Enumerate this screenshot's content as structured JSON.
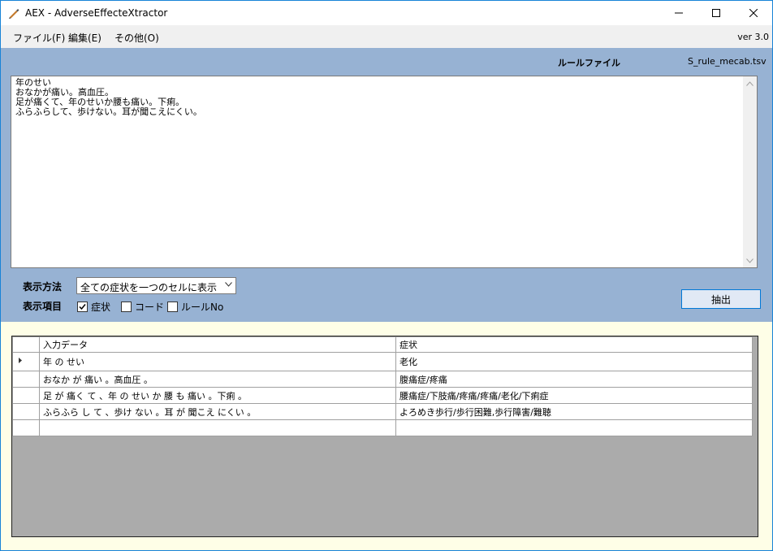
{
  "window": {
    "title": "AEX - AdverseEffecteXtractor",
    "minimize_icon": "minimize-icon",
    "maximize_icon": "maximize-icon",
    "close_icon": "close-icon"
  },
  "menu": {
    "items": [
      {
        "label": "ファイル(F)"
      },
      {
        "label": "編集(E)"
      },
      {
        "label": "その他(O)"
      }
    ],
    "version": "ver 3.0"
  },
  "rule": {
    "title": "ルールファイル",
    "file": "S_rule_mecab.tsv"
  },
  "input_text": {
    "lines": [
      "年のせい",
      "おなかが痛い。高血圧。",
      "足が痛くて、年のせいか腰も痛い。下痢。",
      "ふらふらして、歩けない。耳が聞こえにくい。"
    ]
  },
  "controls": {
    "display_method_label": "表示方法",
    "display_method_value": "全ての症状を一つのセルに表示",
    "display_items_label": "表示項目",
    "checkboxes": [
      {
        "label": "症状",
        "checked": true
      },
      {
        "label": "コード",
        "checked": false
      },
      {
        "label": "ルールNo",
        "checked": false
      }
    ],
    "extract_button": "抽出"
  },
  "grid": {
    "headers": [
      "入力データ",
      "症状"
    ],
    "rows": [
      [
        "年 の せい",
        "老化"
      ],
      [
        "おなか が 痛い 。高血圧 。",
        "腹痛症/疼痛"
      ],
      [
        "足 が 痛く て 、年 の せい か 腰 も 痛い 。下痢 。",
        "腰痛症/下肢痛/疼痛/疼痛/老化/下痢症"
      ],
      [
        "ふらふら し て 、歩け ない 。耳 が 聞こえ にくい 。",
        "よろめき歩行/歩行困難,歩行障害/難聴"
      ],
      [
        "",
        ""
      ]
    ]
  }
}
